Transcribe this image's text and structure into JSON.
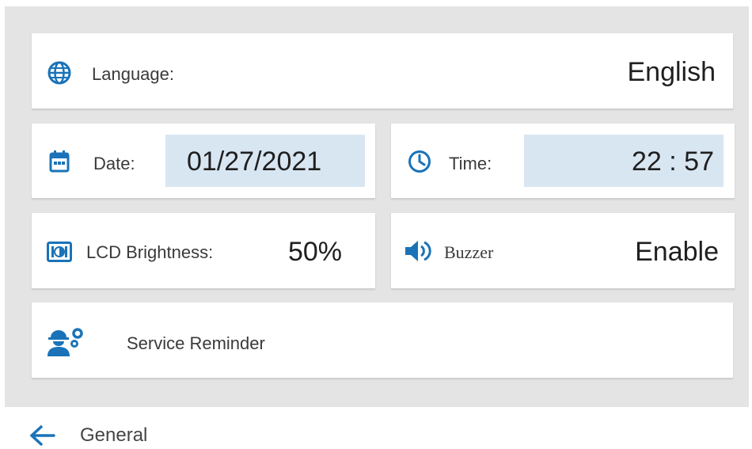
{
  "settings": {
    "language": {
      "label": "Language:",
      "value": "English",
      "icon": "globe-icon"
    },
    "date": {
      "label": "Date:",
      "value": "01/27/2021",
      "icon": "calendar-icon"
    },
    "time": {
      "label": "Time:",
      "value": "22 : 57",
      "icon": "clock-icon"
    },
    "brightness": {
      "label": "LCD Brightness:",
      "value": "50%",
      "icon": "brightness-icon"
    },
    "buzzer": {
      "label": "Buzzer",
      "value": "Enable",
      "icon": "speaker-icon"
    },
    "service": {
      "label": "Service Reminder",
      "icon": "service-worker-icon"
    }
  },
  "footer": {
    "title": "General",
    "back_icon": "arrow-left-icon"
  },
  "colors": {
    "accent": "#1a73b8",
    "field_bg": "#d8e6f2",
    "panel_bg": "#e4e4e4"
  }
}
